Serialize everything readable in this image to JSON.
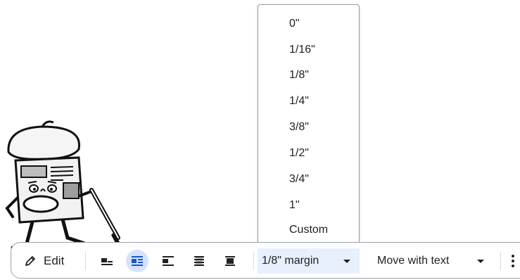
{
  "menu": {
    "items": [
      "0\"",
      "1/16\"",
      "1/8\"",
      "1/4\"",
      "3/8\"",
      "1/2\"",
      "3/4\"",
      "1\"",
      "Custom"
    ]
  },
  "toolbar": {
    "edit_label": "Edit",
    "margin_label": "1/8\" margin",
    "move_label": "Move with text",
    "wrap_buttons": [
      "inline-icon",
      "wrap-text-icon",
      "break-text-icon",
      "behind-text-icon",
      "in-front-of-text-icon"
    ],
    "active_wrap": "wrap-text-icon",
    "accent_color": "#d3e3fd",
    "dropdown_bg": "#e8f0fe"
  },
  "illustration": {
    "name": "newspaper-painter-mascot"
  }
}
